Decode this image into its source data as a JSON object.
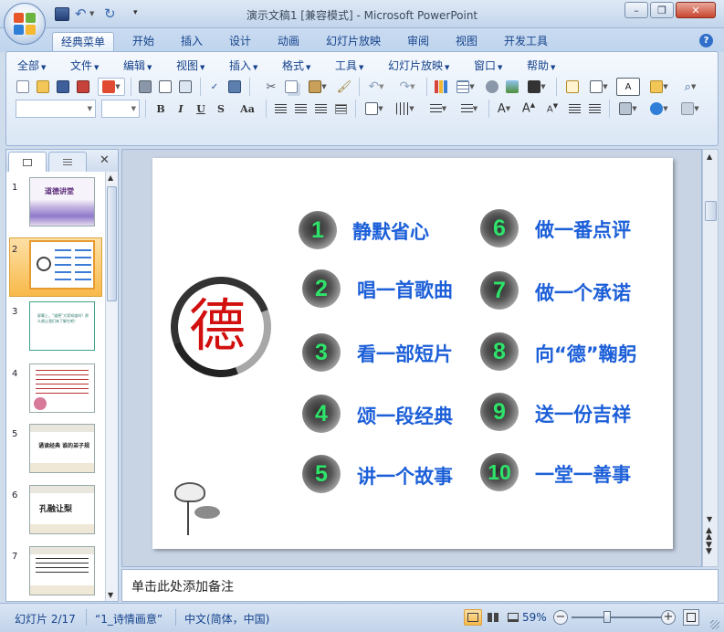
{
  "window": {
    "title": "演示文稿1 [兼容模式] - Microsoft PowerPoint",
    "controls": [
      "minimize",
      "restore",
      "close"
    ]
  },
  "ribbon_tabs": [
    "经典菜单",
    "开始",
    "插入",
    "设计",
    "动画",
    "幻灯片放映",
    "审阅",
    "视图",
    "开发工具"
  ],
  "active_tab": "经典菜单",
  "classic_menu": [
    "全部",
    "文件",
    "编辑",
    "视图",
    "插入",
    "格式",
    "工具",
    "幻灯片放映",
    "窗口",
    "帮助"
  ],
  "format_buttons": [
    "B",
    "I",
    "U",
    "S",
    "Aa"
  ],
  "slide_thumbnails": [
    {
      "num": "1",
      "caption": "道德讲堂"
    },
    {
      "num": "2",
      "caption": ""
    },
    {
      "num": "3",
      "caption": "屏幕上，“道德”大家知道吗？那么就让我们来了解它吧！"
    },
    {
      "num": "4",
      "caption": ""
    },
    {
      "num": "5",
      "caption": "诵读经典 谁的弟子规"
    },
    {
      "num": "6",
      "caption": "孔融让梨"
    },
    {
      "num": "7",
      "caption": ""
    }
  ],
  "slide": {
    "emblem": "德",
    "items": [
      {
        "num": "1",
        "text": "静默省心"
      },
      {
        "num": "2",
        "text": "唱一首歌曲"
      },
      {
        "num": "3",
        "text": "看一部短片"
      },
      {
        "num": "4",
        "text": "颂一段经典"
      },
      {
        "num": "5",
        "text": "讲一个故事"
      },
      {
        "num": "6",
        "text": "做一番点评"
      },
      {
        "num": "7",
        "text": "做一个承诺"
      },
      {
        "num": "8",
        "text": "向“德”鞠躬"
      },
      {
        "num": "9",
        "text": "送一份吉祥"
      },
      {
        "num": "10",
        "text": "一堂一善事"
      }
    ]
  },
  "notes_placeholder": "单击此处添加备注",
  "status": {
    "slide_info": "幻灯片 2/17",
    "theme": "“1_诗情画意”",
    "language": "中文(简体，中国)",
    "zoom": "59%",
    "zoom_level": 0.59
  },
  "colors": {
    "item_text": "#1c5fd8",
    "number": "#2ee36a",
    "emblem": "#d20f0f",
    "thumb_selected": "#e79a2f"
  }
}
